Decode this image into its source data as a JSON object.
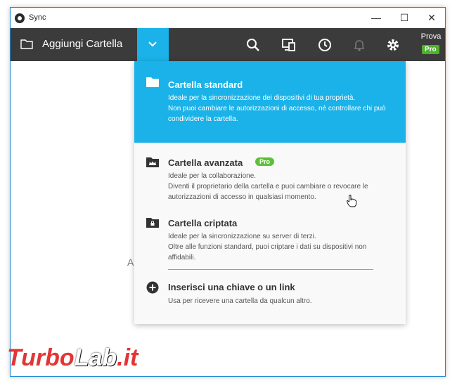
{
  "window": {
    "title": "Sync"
  },
  "window_controls": {
    "minimize": "—",
    "maximize": "☐",
    "close": "✕"
  },
  "toolbar": {
    "add_folder_label": "Aggiungi Cartella",
    "icons": [
      "search-icon",
      "devices-icon",
      "history-icon",
      "bell-icon",
      "gear-icon"
    ],
    "prova_label": "Prova",
    "pro_badge": "Pro",
    "accent": "#1ab2e8"
  },
  "background_hint": "A",
  "menu": {
    "items": [
      {
        "title": "Cartella standard",
        "description": "Ideale per la sincronizzazione dei dispositivi di tua proprietà.\nNon puoi cambiare le autorizzazioni di accesso, né controllare chi può condividere la cartella.",
        "selected": true
      },
      {
        "title": "Cartella avanzata",
        "badge": "Pro",
        "description": "Ideale per la collaborazione.\nDiventi il proprietario della cartella e puoi cambiare o revocare le autorizzazioni di accesso in qualsiasi momento."
      },
      {
        "title": "Cartella criptata",
        "description": "Ideale per la sincronizzazione su server di terzi.\nOltre alle funzioni standard, puoi criptare i dati su dispositivi non affidabili."
      },
      {
        "title": "Inserisci una chiave o un link",
        "description": "Usa per ricevere una cartella da qualcun altro."
      }
    ]
  },
  "watermark": {
    "part1": "TurboLab.it"
  }
}
